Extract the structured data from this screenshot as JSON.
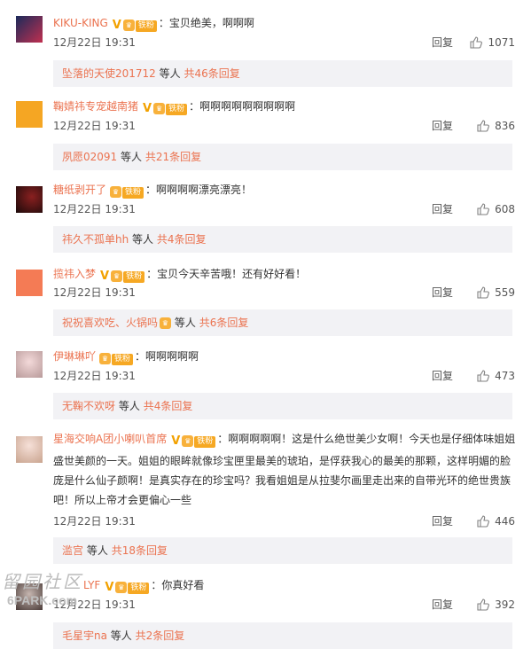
{
  "fan_label": "铁粉",
  "reply_label": "回复",
  "deng_ren": "等人",
  "comments": [
    {
      "user": "KIKU-KING",
      "text": "：宝贝绝美，啊啊啊",
      "time": "12月22日 19:31",
      "likes": "1071",
      "sub_names": "坠落的天使201712",
      "sub_total": "共46条回复"
    },
    {
      "user": "鞠婧祎专宠越南猪",
      "text": "：啊啊啊啊啊啊啊啊啊",
      "time": "12月22日 19:31",
      "likes": "836",
      "sub_names": "夙愿02091",
      "sub_total": "共21条回复"
    },
    {
      "user": "糖纸剥开了",
      "text": "：啊啊啊啊漂亮漂亮！",
      "time": "12月22日 19:31",
      "likes": "608",
      "sub_names": "祎久不孤单hh",
      "sub_total": "共4条回复"
    },
    {
      "user": "揽祎入梦",
      "text": "：宝贝今天辛苦哦！还有好好看！",
      "time": "12月22日 19:31",
      "likes": "559",
      "sub_names": "祝祝喜欢吃、火锅吗",
      "sub_total": "共6条回复"
    },
    {
      "user": "伊琳琳吖",
      "text": "：啊啊啊啊啊",
      "time": "12月22日 19:31",
      "likes": "473",
      "sub_names": "无鞠不欢呀",
      "sub_total": "共4条回复"
    },
    {
      "user": "星海交响A团小喇叭首席",
      "text": "：啊啊啊啊啊！这是什么绝世美少女啊！今天也是仔细体味姐姐盛世美颜的一天。姐姐的眼眸就像珍宝匣里最美的琥珀，是俘获我心的最美的那颗，这样明媚的脸庞是什么仙子颜啊！是真实存在的珍宝吗？我看姐姐是从拉斐尔画里走出来的自带光环的绝世贵族吧！所以上帝才会更偏心一些",
      "time": "12月22日 19:31",
      "likes": "446",
      "sub_names": "滥宫",
      "sub_total": "共18条回复"
    },
    {
      "user": "LYF",
      "text": "：你真好看",
      "time": "12月22日 19:31",
      "likes": "392",
      "sub_names": "毛星宇na",
      "sub_total": "共2条回复"
    }
  ],
  "watermark": {
    "chars": "留园社区",
    "url": "6PARK.com"
  },
  "colors": {
    "accent": "#eb7350",
    "badge": "#f6a823",
    "subbox_bg": "#f2f2f5"
  },
  "icons": [
    "verified-v-icon",
    "hat-badge-icon",
    "thumbs-up-icon"
  ]
}
